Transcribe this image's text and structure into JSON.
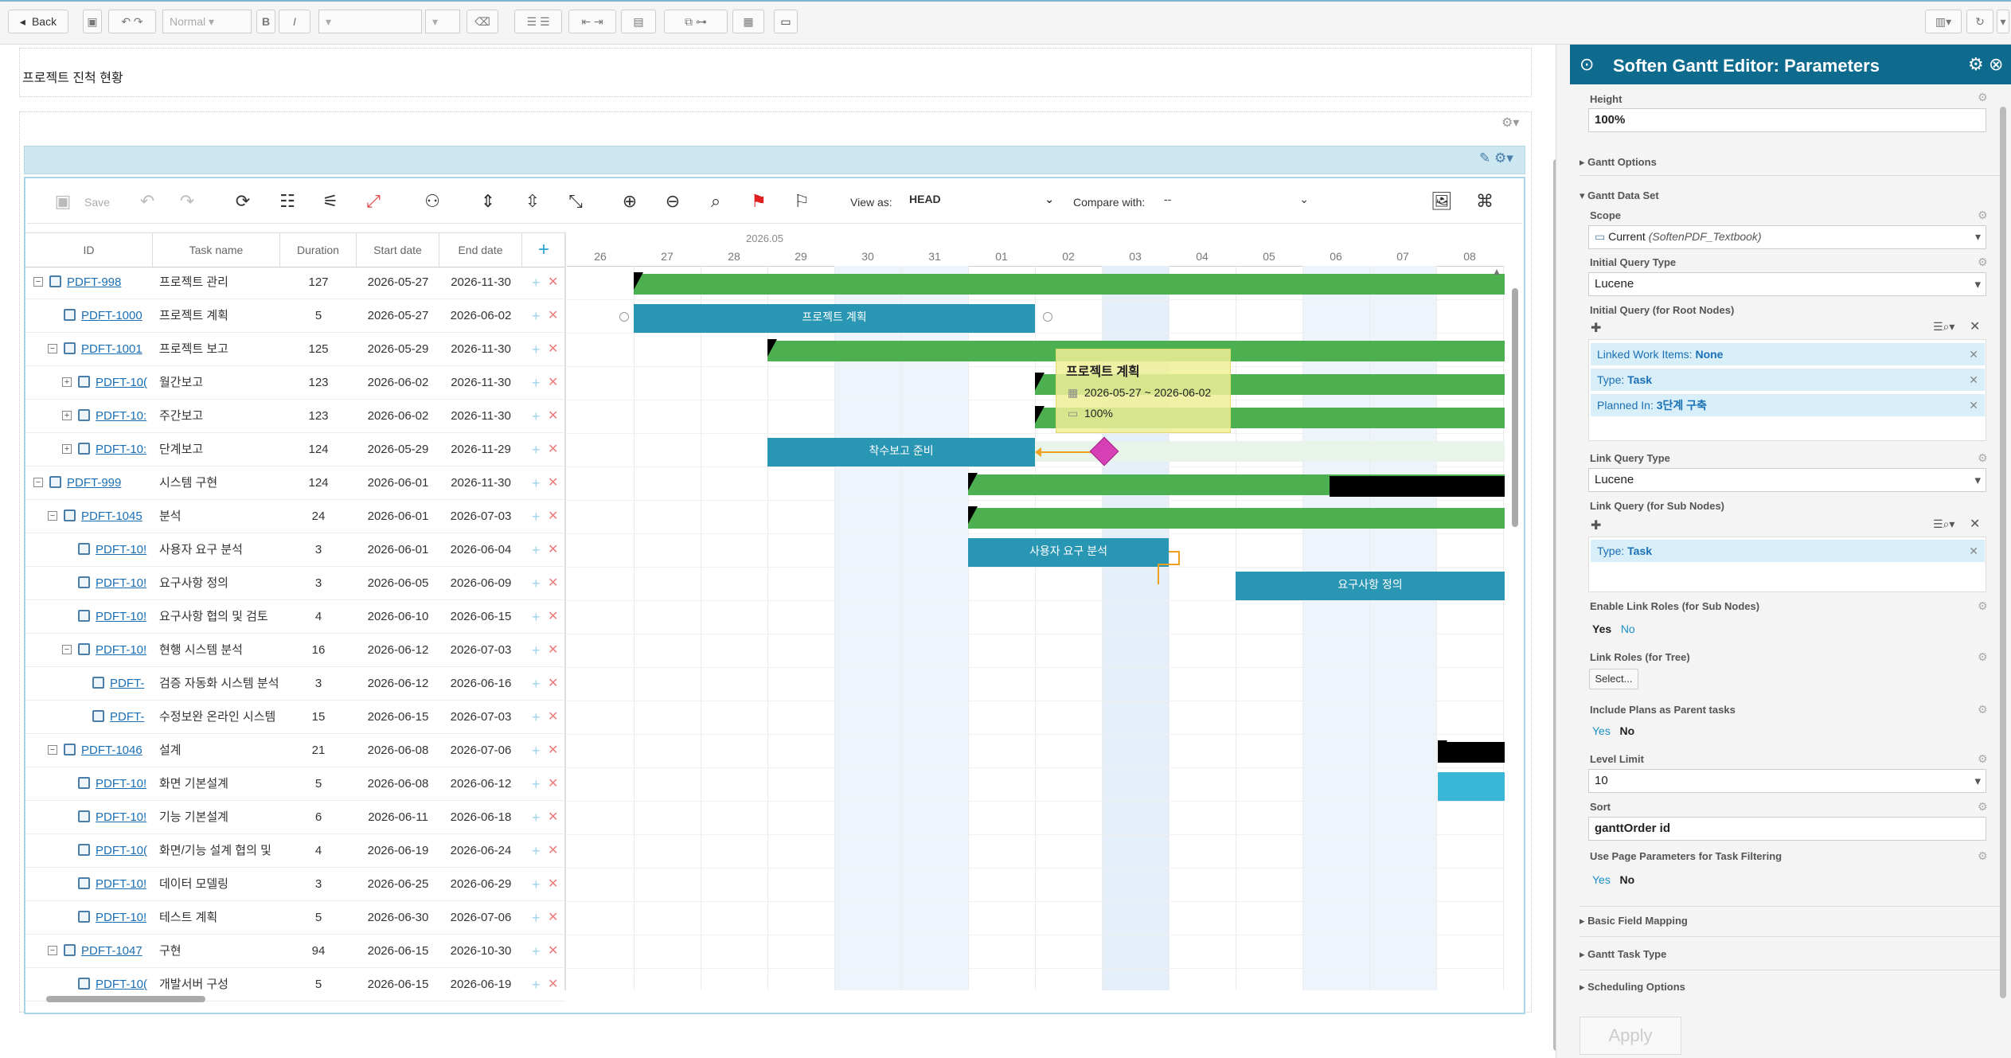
{
  "toolbar": {
    "back_label": "Back",
    "style_select": "Normal",
    "bold": "B",
    "italic": "I"
  },
  "document": {
    "title": "프로젝트 진척 현황"
  },
  "gantt_toolbar": {
    "save_label": "Save",
    "view_as_label": "View as:",
    "view_as_value": "HEAD",
    "compare_with_label": "Compare with:",
    "compare_with_value": "--"
  },
  "grid": {
    "headers": [
      "ID",
      "Task name",
      "Duration",
      "Start date",
      "End date"
    ],
    "rows": [
      {
        "id": "PDFT-998",
        "name": "프로젝트 관리",
        "duration": "127",
        "start": "2026-05-27",
        "end": "2026-11-30"
      },
      {
        "id": "PDFT-1000",
        "name": "프로젝트 계획",
        "duration": "5",
        "start": "2026-05-27",
        "end": "2026-06-02"
      },
      {
        "id": "PDFT-1001",
        "name": "프로젝트 보고",
        "duration": "125",
        "start": "2026-05-29",
        "end": "2026-11-30"
      },
      {
        "id": "PDFT-10(",
        "name": "월간보고",
        "duration": "123",
        "start": "2026-06-02",
        "end": "2026-11-30"
      },
      {
        "id": "PDFT-10:",
        "name": "주간보고",
        "duration": "123",
        "start": "2026-06-02",
        "end": "2026-11-30"
      },
      {
        "id": "PDFT-10:",
        "name": "단계보고",
        "duration": "124",
        "start": "2026-05-29",
        "end": "2026-11-29"
      },
      {
        "id": "PDFT-999",
        "name": "시스템 구현",
        "duration": "124",
        "start": "2026-06-01",
        "end": "2026-11-30"
      },
      {
        "id": "PDFT-1045",
        "name": "분석",
        "duration": "24",
        "start": "2026-06-01",
        "end": "2026-07-03"
      },
      {
        "id": "PDFT-10!",
        "name": "사용자 요구 분석",
        "duration": "3",
        "start": "2026-06-01",
        "end": "2026-06-04"
      },
      {
        "id": "PDFT-10!",
        "name": "요구사항 정의",
        "duration": "3",
        "start": "2026-06-05",
        "end": "2026-06-09"
      },
      {
        "id": "PDFT-10!",
        "name": "요구사항 협의 및 검토",
        "duration": "4",
        "start": "2026-06-10",
        "end": "2026-06-15"
      },
      {
        "id": "PDFT-10!",
        "name": "현행 시스템 분석",
        "duration": "16",
        "start": "2026-06-12",
        "end": "2026-07-03"
      },
      {
        "id": "PDFT-",
        "name": "검증 자동화 시스템 분석",
        "duration": "3",
        "start": "2026-06-12",
        "end": "2026-06-16"
      },
      {
        "id": "PDFT-",
        "name": "수정보완 온라인 시스템",
        "duration": "15",
        "start": "2026-06-15",
        "end": "2026-07-03"
      },
      {
        "id": "PDFT-1046",
        "name": "설계",
        "duration": "21",
        "start": "2026-06-08",
        "end": "2026-07-06"
      },
      {
        "id": "PDFT-10!",
        "name": "화면 기본설계",
        "duration": "5",
        "start": "2026-06-08",
        "end": "2026-06-12"
      },
      {
        "id": "PDFT-10!",
        "name": "기능 기본설계",
        "duration": "6",
        "start": "2026-06-11",
        "end": "2026-06-18"
      },
      {
        "id": "PDFT-10(",
        "name": "화면/기능 설계 협의 및",
        "duration": "4",
        "start": "2026-06-19",
        "end": "2026-06-24"
      },
      {
        "id": "PDFT-10!",
        "name": "데이터 모델링",
        "duration": "3",
        "start": "2026-06-25",
        "end": "2026-06-29"
      },
      {
        "id": "PDFT-10!",
        "name": "테스트 계획",
        "duration": "5",
        "start": "2026-06-30",
        "end": "2026-07-06"
      },
      {
        "id": "PDFT-1047",
        "name": "구현",
        "duration": "94",
        "start": "2026-06-15",
        "end": "2026-10-30"
      },
      {
        "id": "PDFT-10(",
        "name": "개발서버 구성",
        "duration": "5",
        "start": "2026-06-15",
        "end": "2026-06-19"
      }
    ]
  },
  "timeline": {
    "month": "2026.05",
    "days": [
      "26",
      "27",
      "28",
      "29",
      "30",
      "31",
      "01",
      "02",
      "03",
      "04",
      "05",
      "06",
      "07",
      "08"
    ]
  },
  "bars": {
    "plan_label": "프로젝트 계획",
    "kickoff_label": "착수보고 준비",
    "user_req_label": "사용자 요구 분석",
    "req_def_label": "요구사항 정의"
  },
  "tooltip": {
    "title": "프로젝트 계획",
    "dates": "2026-05-27 ~ 2026-06-02",
    "progress": "100%"
  },
  "panel": {
    "title": "Soften Gantt Editor: Parameters",
    "height_label": "Height",
    "height_value": "100%",
    "gantt_options": "Gantt Options",
    "gantt_data_set": "Gantt Data Set",
    "scope_label": "Scope",
    "scope_value": "Current",
    "scope_detail": "(SoftenPDF_Textbook)",
    "initial_query_type_label": "Initial Query Type",
    "initial_query_type_value": "Lucene",
    "initial_query_label": "Initial Query (for Root Nodes)",
    "chips_root": [
      {
        "key": "Linked Work Items:",
        "value": "None"
      },
      {
        "key": "Type:",
        "value": "Task"
      },
      {
        "key": "Planned In:",
        "value": "3단계 구축"
      }
    ],
    "link_query_type_label": "Link Query Type",
    "link_query_type_value": "Lucene",
    "link_query_label": "Link Query (for Sub Nodes)",
    "chips_sub": [
      {
        "key": "Type:",
        "value": "Task"
      }
    ],
    "enable_link_roles_label": "Enable Link Roles (for Sub Nodes)",
    "yes": "Yes",
    "no": "No",
    "link_roles_label": "Link Roles (for Tree)",
    "select_button": "Select...",
    "include_plans_label": "Include Plans as Parent tasks",
    "level_limit_label": "Level Limit",
    "level_limit_value": "10",
    "sort_label": "Sort",
    "sort_value": "ganttOrder id",
    "use_page_params_label": "Use Page Parameters for Task Filtering",
    "basic_field_mapping": "Basic Field Mapping",
    "gantt_task_type": "Gantt Task Type",
    "scheduling_options": "Scheduling Options",
    "apply_button": "Apply"
  }
}
